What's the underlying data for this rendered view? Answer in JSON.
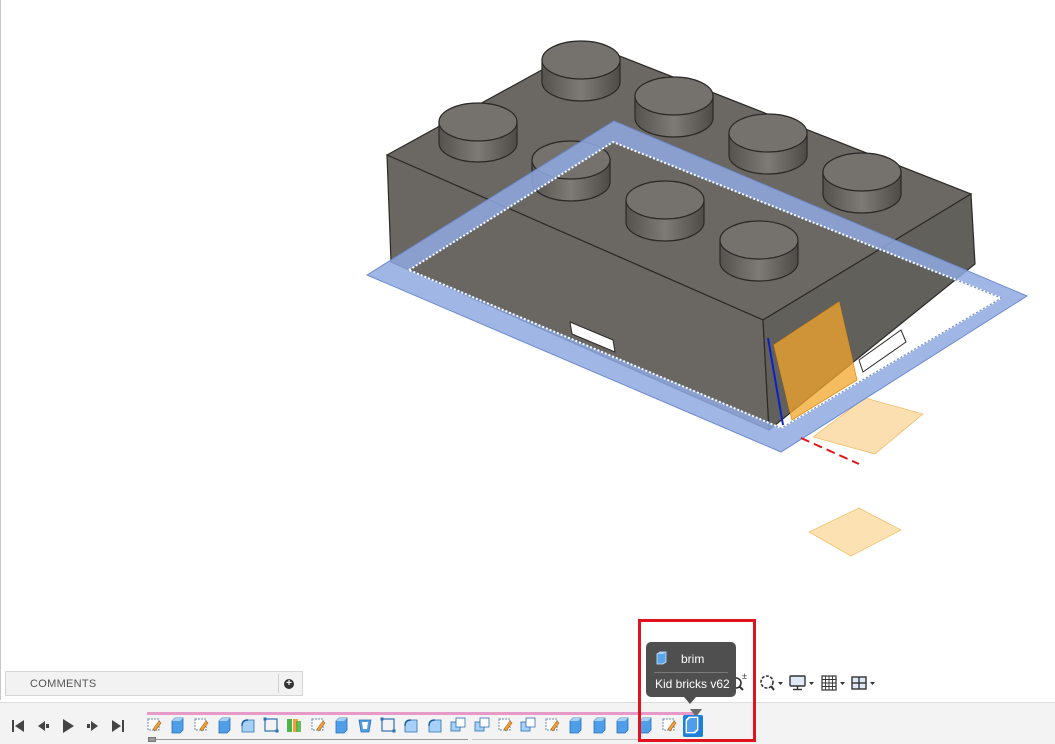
{
  "comments": {
    "label": "COMMENTS",
    "add_symbol": "+"
  },
  "tooltip": {
    "feature_name": "brim",
    "document_version": "Kid bricks v62",
    "icon": "body-icon"
  },
  "view_toolbar": {
    "items": [
      {
        "name": "zoom-window-icon",
        "symbol": "±"
      },
      {
        "name": "zoom-icon"
      },
      {
        "name": "display-settings-icon"
      },
      {
        "name": "grid-icon"
      },
      {
        "name": "viewports-icon"
      }
    ]
  },
  "playback": {
    "buttons": [
      "skip-to-start",
      "step-back",
      "play",
      "step-forward",
      "skip-to-end"
    ]
  },
  "timeline": {
    "features": [
      "sketch",
      "extrude",
      "sketch",
      "extrude",
      "fillet",
      "sketch-curve",
      "pattern",
      "sketch",
      "extrude",
      "shell",
      "sketch-curve",
      "fillet",
      "fillet",
      "combine",
      "combine",
      "sketch",
      "combine",
      "sketch",
      "extrude",
      "extrude",
      "extrude",
      "extrude",
      "sketch",
      "brim"
    ],
    "active_index": 23
  },
  "colors": {
    "brick": "#6e6b66",
    "brim": "#8fa9e0",
    "plane": "#f7c46a",
    "timeline_track": "#e79ac8",
    "highlight": "#e0141e",
    "active_feature": "#1e7fd6"
  }
}
